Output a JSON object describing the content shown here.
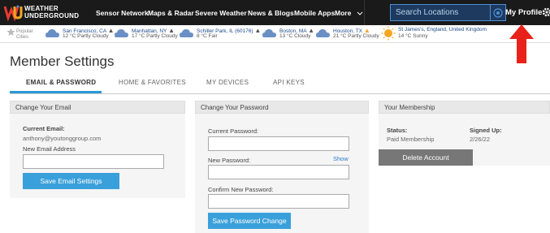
{
  "brand": {
    "logo_line1": "WEATHER",
    "logo_line2": "UNDERGROUND",
    "logo_colors": [
      "#e83a30",
      "#f5a623",
      "#4a90d9"
    ]
  },
  "nav": {
    "items": [
      "Sensor Network",
      "Maps & Radar",
      "Severe Weather",
      "News & Blogs",
      "Mobile Apps",
      "More"
    ],
    "more_chevron": "chevron-down-icon",
    "search_placeholder": "Search Locations",
    "locate_icon": "target-icon",
    "profile_label": "My Profile",
    "settings_icon": "gear-icon"
  },
  "popular": {
    "label_line1": "Popular",
    "label_line2": "Cities",
    "star_icon": "star-icon",
    "cities": [
      {
        "name": "San Francisco, CA",
        "temp": "12 °C Partly Cloudy",
        "icon": "partly-cloudy-icon"
      },
      {
        "name": "Manhattan, NY",
        "temp": "17 °C Partly Cloudy",
        "icon": "partly-cloudy-icon"
      },
      {
        "name": "Schiller Park, IL (60176)",
        "temp": "8 °C Fair",
        "icon": "partly-cloudy-icon"
      },
      {
        "name": "Boston, MA",
        "temp": "13 °C Cloudy",
        "icon": "cloudy-icon"
      },
      {
        "name": "Houston, TX",
        "temp": "21 °C Partly Cloudy",
        "icon": "partly-cloudy-icon",
        "alert": true
      },
      {
        "name": "St James's, England, United Kingdom",
        "temp": "14 °C Sunny",
        "icon": "sunny-icon"
      }
    ]
  },
  "page": {
    "title": "Member Settings",
    "tabs": [
      "EMAIL & PASSWORD",
      "HOME & FAVORITES",
      "MY DEVICES",
      "API KEYS"
    ],
    "active_tab": "EMAIL & PASSWORD"
  },
  "email_panel": {
    "heading": "Change Your Email",
    "current_label": "Current Email:",
    "current_value": "anthony@youtonggroup.com",
    "new_label": "New Email Address",
    "new_value": "",
    "save_label": "Save Email Settings"
  },
  "password_panel": {
    "heading": "Change Your Password",
    "current_label": "Current Password:",
    "new_label": "New Password:",
    "show_label": "Show",
    "confirm_label": "Confirm New Password:",
    "save_label": "Save Password Change"
  },
  "membership_panel": {
    "heading": "Your Membership",
    "status_label": "Status:",
    "status_value": "Paid Membership",
    "signed_label": "Signed Up:",
    "signed_value": "2/26/22",
    "delete_label": "Delete Account"
  },
  "colors": {
    "accent": "#2a9ad8",
    "button": "#3aa0db",
    "nav_bg": "#1a1a1a",
    "annotation_arrow": "#e8221a"
  }
}
